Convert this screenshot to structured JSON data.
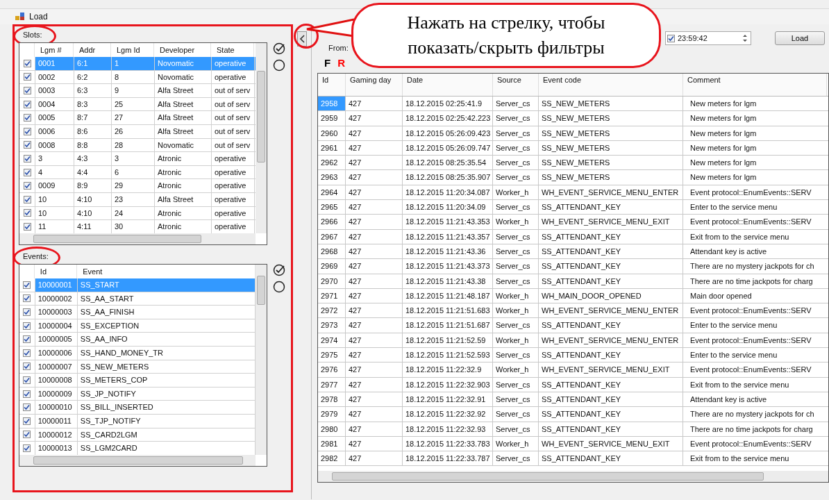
{
  "window": {
    "title": "Load"
  },
  "callout": {
    "text": "Нажать на стрелку, чтобы показать/скрыть фильтры"
  },
  "slots": {
    "label": "Slots:",
    "columns": [
      "Lgm #",
      "Addr",
      "Lgm Id",
      "Developer",
      "State"
    ],
    "rows": [
      {
        "checked": true,
        "selected": true,
        "cells": [
          "0001",
          "6:1",
          "1",
          "Novomatic",
          "operative"
        ]
      },
      {
        "checked": true,
        "selected": false,
        "cells": [
          "0002",
          "6:2",
          "8",
          "Novomatic",
          "operative"
        ]
      },
      {
        "checked": true,
        "selected": false,
        "cells": [
          "0003",
          "6:3",
          "9",
          "Alfa Street",
          "out of serv"
        ]
      },
      {
        "checked": true,
        "selected": false,
        "cells": [
          "0004",
          "8:3",
          "25",
          "Alfa Street",
          "out of serv"
        ]
      },
      {
        "checked": true,
        "selected": false,
        "cells": [
          "0005",
          "8:7",
          "27",
          "Alfa Street",
          "out of serv"
        ]
      },
      {
        "checked": true,
        "selected": false,
        "cells": [
          "0006",
          "8:6",
          "26",
          "Alfa Street",
          "out of serv"
        ]
      },
      {
        "checked": true,
        "selected": false,
        "cells": [
          "0008",
          "8:8",
          "28",
          "Novomatic",
          "out of serv"
        ]
      },
      {
        "checked": true,
        "selected": false,
        "cells": [
          "3",
          "4:3",
          "3",
          "Atronic",
          "operative"
        ]
      },
      {
        "checked": true,
        "selected": false,
        "cells": [
          "4",
          "4:4",
          "6",
          "Atronic",
          "operative"
        ]
      },
      {
        "checked": true,
        "selected": false,
        "cells": [
          "0009",
          "8:9",
          "29",
          "Atronic",
          "operative"
        ]
      },
      {
        "checked": true,
        "selected": false,
        "cells": [
          "10",
          "4:10",
          "23",
          "Alfa Street",
          "operative"
        ]
      },
      {
        "checked": true,
        "selected": false,
        "cells": [
          "10",
          "4:10",
          "24",
          "Atronic",
          "operative"
        ]
      },
      {
        "checked": true,
        "selected": false,
        "cells": [
          "11",
          "4:11",
          "30",
          "Atronic",
          "operative"
        ]
      }
    ]
  },
  "events": {
    "label": "Events:",
    "columns": [
      "Id",
      "Event"
    ],
    "rows": [
      {
        "checked": true,
        "selected": true,
        "cells": [
          "10000001",
          "SS_START"
        ]
      },
      {
        "checked": true,
        "selected": false,
        "cells": [
          "10000002",
          "SS_AA_START"
        ]
      },
      {
        "checked": true,
        "selected": false,
        "cells": [
          "10000003",
          "SS_AA_FINISH"
        ]
      },
      {
        "checked": true,
        "selected": false,
        "cells": [
          "10000004",
          "SS_EXCEPTION"
        ]
      },
      {
        "checked": true,
        "selected": false,
        "cells": [
          "10000005",
          "SS_AA_INFO"
        ]
      },
      {
        "checked": true,
        "selected": false,
        "cells": [
          "10000006",
          "SS_HAND_MONEY_TR"
        ]
      },
      {
        "checked": true,
        "selected": false,
        "cells": [
          "10000007",
          "SS_NEW_METERS"
        ]
      },
      {
        "checked": true,
        "selected": false,
        "cells": [
          "10000008",
          "SS_METERS_COP"
        ]
      },
      {
        "checked": true,
        "selected": false,
        "cells": [
          "10000009",
          "SS_JP_NOTIFY"
        ]
      },
      {
        "checked": true,
        "selected": false,
        "cells": [
          "10000010",
          "SS_BILL_INSERTED"
        ]
      },
      {
        "checked": true,
        "selected": false,
        "cells": [
          "10000011",
          "SS_TJP_NOTIFY"
        ]
      },
      {
        "checked": true,
        "selected": false,
        "cells": [
          "10000012",
          "SS_CARD2LGM"
        ]
      },
      {
        "checked": true,
        "selected": false,
        "cells": [
          "10000013",
          "SS_LGM2CARD"
        ]
      }
    ]
  },
  "filters": {
    "from_label": "From:",
    "time": "23:59:42",
    "time_checked": true,
    "load_button": "Load"
  },
  "toolbar": [
    {
      "label": "F",
      "color": "#000000"
    },
    {
      "label": "R",
      "color": "#ff0000"
    }
  ],
  "log": {
    "columns": [
      "Id",
      "Gaming day",
      "Date",
      "Source",
      "Event code",
      "Comment"
    ],
    "rows": [
      {
        "selected": true,
        "cells": [
          "2958",
          "427",
          "18.12.2015 02:25:41.9",
          "Server_cs",
          "SS_NEW_METERS",
          "New meters for lgm"
        ]
      },
      {
        "selected": false,
        "cells": [
          "2959",
          "427",
          "18.12.2015 02:25:42.223",
          "Server_cs",
          "SS_NEW_METERS",
          "New meters for lgm"
        ]
      },
      {
        "selected": false,
        "cells": [
          "2960",
          "427",
          "18.12.2015 05:26:09.423",
          "Server_cs",
          "SS_NEW_METERS",
          "New meters for lgm"
        ]
      },
      {
        "selected": false,
        "cells": [
          "2961",
          "427",
          "18.12.2015 05:26:09.747",
          "Server_cs",
          "SS_NEW_METERS",
          "New meters for lgm"
        ]
      },
      {
        "selected": false,
        "cells": [
          "2962",
          "427",
          "18.12.2015 08:25:35.54",
          "Server_cs",
          "SS_NEW_METERS",
          "New meters for lgm"
        ]
      },
      {
        "selected": false,
        "cells": [
          "2963",
          "427",
          "18.12.2015 08:25:35.907",
          "Server_cs",
          "SS_NEW_METERS",
          "New meters for lgm"
        ]
      },
      {
        "selected": false,
        "cells": [
          "2964",
          "427",
          "18.12.2015 11:20:34.087",
          "Worker_h",
          "WH_EVENT_SERVICE_MENU_ENTER",
          "Event protocol::EnumEvents::SERV"
        ]
      },
      {
        "selected": false,
        "cells": [
          "2965",
          "427",
          "18.12.2015 11:20:34.09",
          "Server_cs",
          "SS_ATTENDANT_KEY",
          "Enter to the service menu"
        ]
      },
      {
        "selected": false,
        "cells": [
          "2966",
          "427",
          "18.12.2015 11:21:43.353",
          "Worker_h",
          "WH_EVENT_SERVICE_MENU_EXIT",
          "Event protocol::EnumEvents::SERV"
        ]
      },
      {
        "selected": false,
        "cells": [
          "2967",
          "427",
          "18.12.2015 11:21:43.357",
          "Server_cs",
          "SS_ATTENDANT_KEY",
          "Exit from to the service menu"
        ]
      },
      {
        "selected": false,
        "cells": [
          "2968",
          "427",
          "18.12.2015 11:21:43.36",
          "Server_cs",
          "SS_ATTENDANT_KEY",
          "Attendant key is active"
        ]
      },
      {
        "selected": false,
        "cells": [
          "2969",
          "427",
          "18.12.2015 11:21:43.373",
          "Server_cs",
          "SS_ATTENDANT_KEY",
          "There are no mystery jackpots for ch"
        ]
      },
      {
        "selected": false,
        "cells": [
          "2970",
          "427",
          "18.12.2015 11:21:43.38",
          "Server_cs",
          "SS_ATTENDANT_KEY",
          "There are no time jackpots for charg"
        ]
      },
      {
        "selected": false,
        "cells": [
          "2971",
          "427",
          "18.12.2015 11:21:48.187",
          "Worker_h",
          "WH_MAIN_DOOR_OPENED",
          "Main door opened"
        ]
      },
      {
        "selected": false,
        "cells": [
          "2972",
          "427",
          "18.12.2015 11:21:51.683",
          "Worker_h",
          "WH_EVENT_SERVICE_MENU_ENTER",
          "Event protocol::EnumEvents::SERV"
        ]
      },
      {
        "selected": false,
        "cells": [
          "2973",
          "427",
          "18.12.2015 11:21:51.687",
          "Server_cs",
          "SS_ATTENDANT_KEY",
          "Enter to the service menu"
        ]
      },
      {
        "selected": false,
        "cells": [
          "2974",
          "427",
          "18.12.2015 11:21:52.59",
          "Worker_h",
          "WH_EVENT_SERVICE_MENU_ENTER",
          "Event protocol::EnumEvents::SERV"
        ]
      },
      {
        "selected": false,
        "cells": [
          "2975",
          "427",
          "18.12.2015 11:21:52.593",
          "Server_cs",
          "SS_ATTENDANT_KEY",
          "Enter to the service menu"
        ]
      },
      {
        "selected": false,
        "cells": [
          "2976",
          "427",
          "18.12.2015 11:22:32.9",
          "Worker_h",
          "WH_EVENT_SERVICE_MENU_EXIT",
          "Event protocol::EnumEvents::SERV"
        ]
      },
      {
        "selected": false,
        "cells": [
          "2977",
          "427",
          "18.12.2015 11:22:32.903",
          "Server_cs",
          "SS_ATTENDANT_KEY",
          "Exit from to the service menu"
        ]
      },
      {
        "selected": false,
        "cells": [
          "2978",
          "427",
          "18.12.2015 11:22:32.91",
          "Server_cs",
          "SS_ATTENDANT_KEY",
          "Attendant key is active"
        ]
      },
      {
        "selected": false,
        "cells": [
          "2979",
          "427",
          "18.12.2015 11:22:32.92",
          "Server_cs",
          "SS_ATTENDANT_KEY",
          "There are no mystery jackpots for ch"
        ]
      },
      {
        "selected": false,
        "cells": [
          "2980",
          "427",
          "18.12.2015 11:22:32.93",
          "Server_cs",
          "SS_ATTENDANT_KEY",
          "There are no time jackpots for charg"
        ]
      },
      {
        "selected": false,
        "cells": [
          "2981",
          "427",
          "18.12.2015 11:22:33.783",
          "Worker_h",
          "WH_EVENT_SERVICE_MENU_EXIT",
          "Event protocol::EnumEvents::SERV"
        ]
      },
      {
        "selected": false,
        "cells": [
          "2982",
          "427",
          "18.12.2015 11:22:33.787",
          "Server_cs",
          "SS_ATTENDANT_KEY",
          "Exit from to the service menu"
        ]
      }
    ]
  }
}
